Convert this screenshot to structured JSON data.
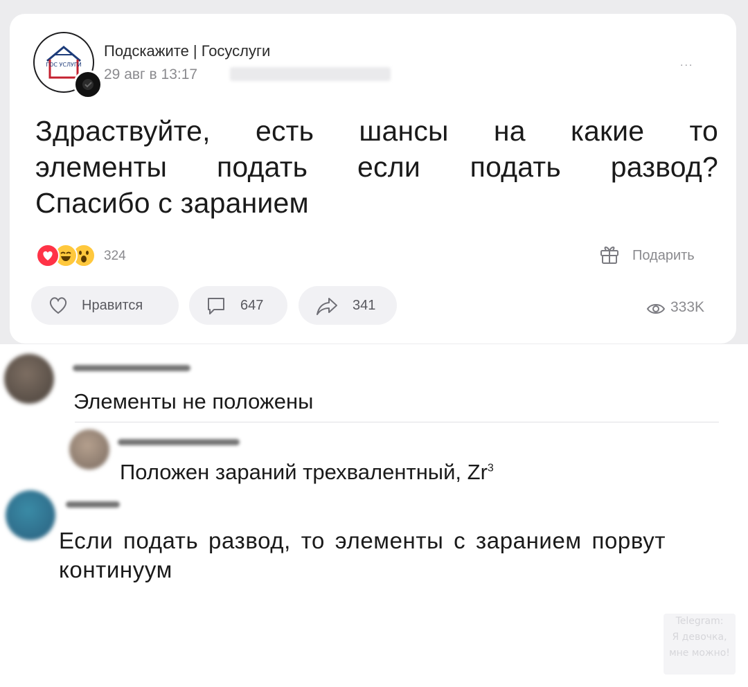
{
  "post": {
    "group_name": "Подскажите | Госуслуги",
    "date": "29 авг в 13:17",
    "logo_text": "ГОС УСЛУГИ",
    "more_label": "...",
    "text_lines": [
      "Здраствуйте, есть шансы на какие то",
      "элементы подать если подать развод?",
      "Спасибо с заранием"
    ],
    "reactions": {
      "icons": [
        "heart-reaction",
        "laugh-reaction",
        "surprised-reaction"
      ],
      "count": "324"
    },
    "gift_label": "Подарить",
    "actions": {
      "like_label": "Нравится",
      "comments_count": "647",
      "shares_count": "341"
    },
    "views": "333K"
  },
  "comments": [
    {
      "text": "Элементы не положены"
    },
    {
      "text": "Положен зараний трехвалентный, Zr",
      "sup": "3"
    },
    {
      "text_lines": [
        "Если подать развод, то элементы с заранием порвут",
        "континуум"
      ]
    }
  ],
  "watermark": [
    "Telegram:",
    "Я девочка,",
    "мне можно!"
  ],
  "colors": {
    "background_band": "#ececee",
    "card": "#ffffff",
    "pill": "#f1f1f4",
    "muted_text": "#8a8a8e",
    "heart": "#ff3347",
    "emoji": "#ffc83d"
  }
}
